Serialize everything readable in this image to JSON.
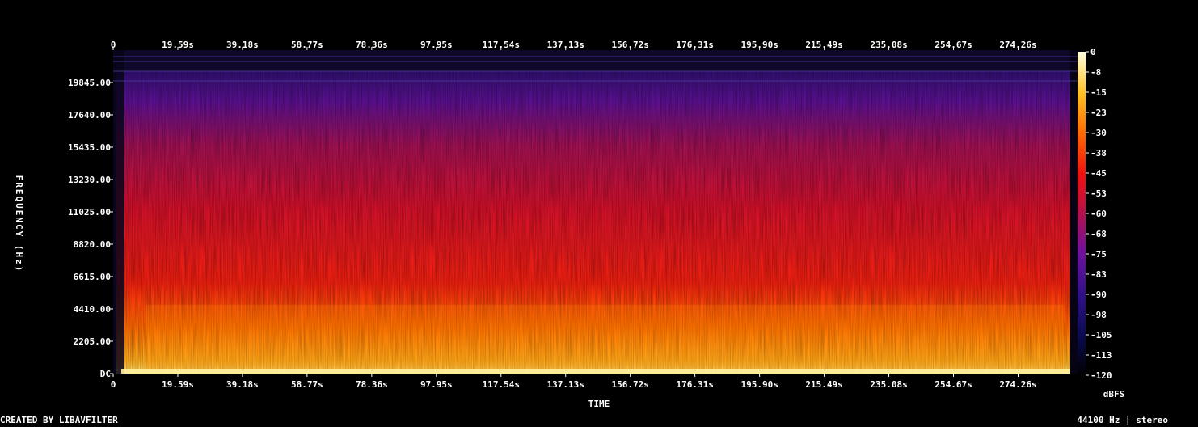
{
  "chart_data": {
    "type": "heatmap",
    "title": "",
    "xlabel": "TIME",
    "ylabel": "FREQUENCY (Hz)",
    "x_ticks": [
      "0",
      "19.59s",
      "39.18s",
      "58.77s",
      "78.36s",
      "97.95s",
      "117.54s",
      "137.13s",
      "156.72s",
      "176.31s",
      "195.90s",
      "215.49s",
      "235.08s",
      "254.67s",
      "274.26s"
    ],
    "y_ticks": [
      "DC",
      "2205.00",
      "4410.00",
      "6615.00",
      "8820.00",
      "11025.00",
      "13230.00",
      "15435.00",
      "17640.00",
      "19845.00"
    ],
    "y_tick_values_hz": [
      0,
      2205,
      4410,
      6615,
      8820,
      11025,
      13230,
      15435,
      17640,
      19845
    ],
    "x_tick_values_s": [
      0,
      19.59,
      39.18,
      58.77,
      78.36,
      97.95,
      117.54,
      137.13,
      156.72,
      176.31,
      195.9,
      215.49,
      235.08,
      254.67,
      274.26
    ],
    "xlim": [
      0,
      293
    ],
    "ylim": [
      0,
      22050
    ],
    "colorbar": {
      "label": "dBFS",
      "ticks": [
        "0",
        "-8",
        "-15",
        "-23",
        "-30",
        "-38",
        "-45",
        "-53",
        "-60",
        "-68",
        "-75",
        "-83",
        "-90",
        "-98",
        "-105",
        "-113",
        "-120"
      ],
      "range": [
        -120,
        0
      ],
      "colormap": "intensity (black-blue-purple-red-orange-yellow-white)"
    },
    "sample_rate_hz": 44100,
    "channels": "stereo"
  },
  "footer": {
    "left": "CREATED BY LIBAVFILTER",
    "right": "44100 Hz | stereo"
  }
}
